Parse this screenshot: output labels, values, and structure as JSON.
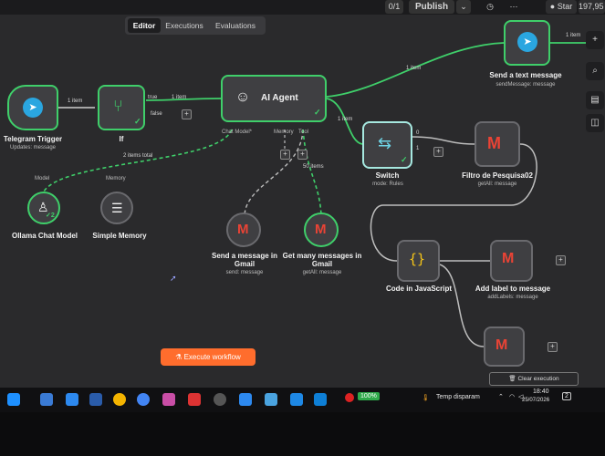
{
  "topbar": {
    "counter": "0/1",
    "publish_label": "Publish",
    "star_label": "Star",
    "star_count": "197,95"
  },
  "tabs": [
    "Editor",
    "Executions",
    "Evaluations"
  ],
  "nodes": {
    "telegram_trigger": {
      "title": "Telegram Trigger",
      "sub": "Updates: message"
    },
    "if": {
      "title": "If"
    },
    "ai_agent": {
      "title": "AI Agent",
      "ports": [
        "Chat Model*",
        "Memory",
        "Tool"
      ]
    },
    "send_text": {
      "title": "Send a text message",
      "sub": "sendMessage: message"
    },
    "switch": {
      "title": "Switch",
      "sub": "mode: Rules"
    },
    "filtro": {
      "title": "Filtro de Pesquisa02",
      "sub": "getAll: message"
    },
    "ollama": {
      "title": "Ollama Chat Model",
      "top": "Model"
    },
    "memory": {
      "title": "Simple Memory",
      "top": "Memory"
    },
    "send_gmail": {
      "title": "Send a message in Gmail",
      "sub": "send: message"
    },
    "get_gmail": {
      "title": "Get many messages in Gmail",
      "sub": "getAll: message"
    },
    "code_js": {
      "title": "Code in JavaScript"
    },
    "add_label": {
      "title": "Add label to message",
      "sub": "addLabels: message"
    }
  },
  "edge_labels": {
    "trigger_if": "1 item",
    "if_true": "true",
    "if_false": "false",
    "if_agent": "1 item",
    "agent_send": "1 item",
    "agent_switch": "1 item",
    "send_out": "1 item",
    "model_items": "2 items total",
    "tool_items": "50 items",
    "switch_out0": "0",
    "switch_out1": "1",
    "ollama_count": "2"
  },
  "execute_label": "Execute workflow",
  "clear_label": "Clear execution",
  "taskbar": {
    "battery": "100%",
    "weather": "Temp disparam",
    "time": "18:40",
    "date": "25/07/2026",
    "notif": "2"
  },
  "colors": {
    "accent_green": "#3fcf6a",
    "execute_orange": "#ff6d2d",
    "canvas": "#2a2a2c"
  }
}
